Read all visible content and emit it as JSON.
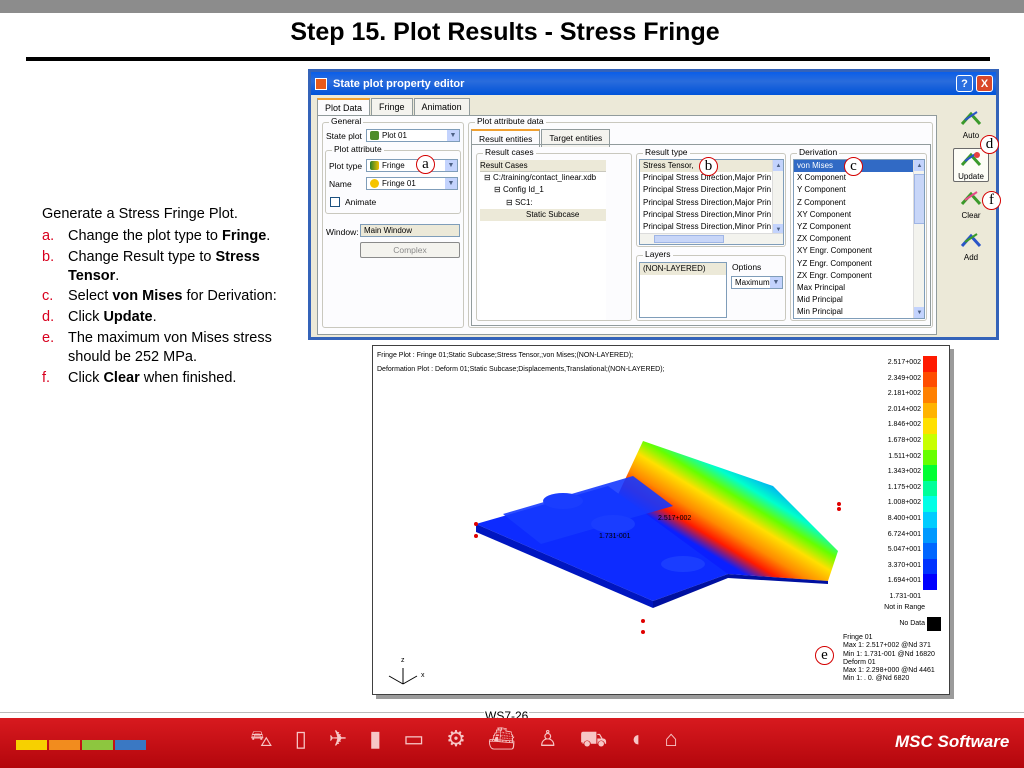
{
  "slide": {
    "title": "Step 15. Plot Results - Stress Fringe",
    "page_number": "WS7-26"
  },
  "instructions": {
    "intro": "Generate a Stress Fringe Plot.",
    "steps": [
      {
        "letter": "a.",
        "pre": "Change the plot type to ",
        "bold": "Fringe",
        "post": "."
      },
      {
        "letter": "b.",
        "pre": "Change Result type to ",
        "bold": "Stress Tensor",
        "post": "."
      },
      {
        "letter": "c.",
        "pre": "Select ",
        "bold": "von Mises",
        "post": " for Derivation:"
      },
      {
        "letter": "d.",
        "pre": "Click ",
        "bold": "Update",
        "post": "."
      },
      {
        "letter": "e.",
        "pre": "The maximum von Mises stress should be 252 MPa.",
        "bold": "",
        "post": ""
      },
      {
        "letter": "f.",
        "pre": "Click ",
        "bold": "Clear",
        "post": " when finished."
      }
    ]
  },
  "editor": {
    "window_title": "State plot property editor",
    "help_glyph": "?",
    "close_glyph": "X",
    "tabs": [
      "Plot Data",
      "Fringe",
      "Animation"
    ],
    "general": {
      "group_label": "General",
      "state_plot_label": "State plot",
      "state_plot_value": "Plot 01",
      "plot_attribute_label": "Plot attribute",
      "plot_type_label": "Plot type",
      "plot_type_value": "Fringe",
      "name_label": "Name",
      "name_value": "Fringe 01",
      "animate_label": "Animate",
      "window_label": "Window:",
      "window_value": "Main Window",
      "complex_button": "Complex"
    },
    "plot_attribute_data": {
      "group_label": "Plot attribute data",
      "tabs": [
        "Result entities",
        "Target entities"
      ],
      "result_cases_label": "Result cases",
      "result_cases_header": "Result Cases",
      "tree": [
        {
          "glyph": "⊟",
          "text": "C:/training/contact_linear.xdb"
        },
        {
          "glyph": "⊟",
          "text": "Config Id_1"
        },
        {
          "glyph": "⊟",
          "text": "SC1:"
        },
        {
          "glyph": "",
          "text": "Static Subcase"
        }
      ],
      "result_type_label": "Result type",
      "result_types": [
        "Stress Tensor,",
        "Principal Stress Direction,Major Prin :",
        "Principal Stress Direction,Major Prin :",
        "Principal Stress Direction,Major Prin :",
        "Principal Stress Direction,Minor Prin :",
        "Principal Stress Direction,Minor Prin :"
      ],
      "layers_label": "Layers",
      "layers_value": "(NON-LAYERED)",
      "options_label": "Options",
      "options_value": "Maximum",
      "derivation_label": "Derivation",
      "derivations": [
        "von Mises",
        "X Component",
        "Y Component",
        "Z Component",
        "XY Component",
        "YZ Component",
        "ZX Component",
        "XY Engr. Component",
        "YZ Engr. Component",
        "ZX Engr. Component",
        "Max Principal",
        "Mid Principal",
        "Min Principal"
      ]
    },
    "side_buttons": {
      "auto": "Auto",
      "update": "Update",
      "clear": "Clear",
      "add": "Add"
    }
  },
  "callouts": {
    "a": "a",
    "b": "b",
    "c": "c",
    "d": "d",
    "e": "e",
    "f": "f"
  },
  "viewport": {
    "header_line1": "Fringe Plot : Fringe 01;Static Subcase;Stress Tensor,;von Mises;(NON-LAYERED);",
    "header_line2": "Deformation Plot : Deform 01;Static Subcase;Displacements,Translational;(NON-LAYERED);",
    "max_label": "2.517+002",
    "min_label": "1.731-001",
    "legend": [
      {
        "label": "2.517+002",
        "color": "#ff1a00"
      },
      {
        "label": "2.349+002",
        "color": "#ff4d00"
      },
      {
        "label": "2.181+002",
        "color": "#ff8000"
      },
      {
        "label": "2.014+002",
        "color": "#ffb300"
      },
      {
        "label": "1.846+002",
        "color": "#ffe000"
      },
      {
        "label": "1.678+002",
        "color": "#c8ff00"
      },
      {
        "label": "1.511+002",
        "color": "#66ff00"
      },
      {
        "label": "1.343+002",
        "color": "#00ff33"
      },
      {
        "label": "1.175+002",
        "color": "#00ff99"
      },
      {
        "label": "1.008+002",
        "color": "#00ffe6"
      },
      {
        "label": "8.400+001",
        "color": "#00ccff"
      },
      {
        "label": "6.724+001",
        "color": "#0099ff"
      },
      {
        "label": "5.047+001",
        "color": "#0066ff"
      },
      {
        "label": "3.370+001",
        "color": "#0033ff"
      },
      {
        "label": "1.694+001",
        "color": "#0000ff"
      },
      {
        "label": "1.731-001",
        "color": ""
      }
    ],
    "not_in_range": "Not in Range",
    "no_data": "No Data",
    "info": [
      "Fringe 01",
      "Max 1: 2.517+002 @Nd 371",
      "Min 1: 1.731-001 @Nd 16820",
      "Deform 01",
      "Max 1: 2.298+000 @Nd 4461",
      "Min 1: . 0. @Nd 6820"
    ],
    "axis_z": "z",
    "axis_x": "x"
  },
  "footer": {
    "logo": "MSC Software",
    "strip_colors": [
      "#f7d000",
      "#f28c1e",
      "#8dc63f",
      "#3a78c3"
    ]
  }
}
